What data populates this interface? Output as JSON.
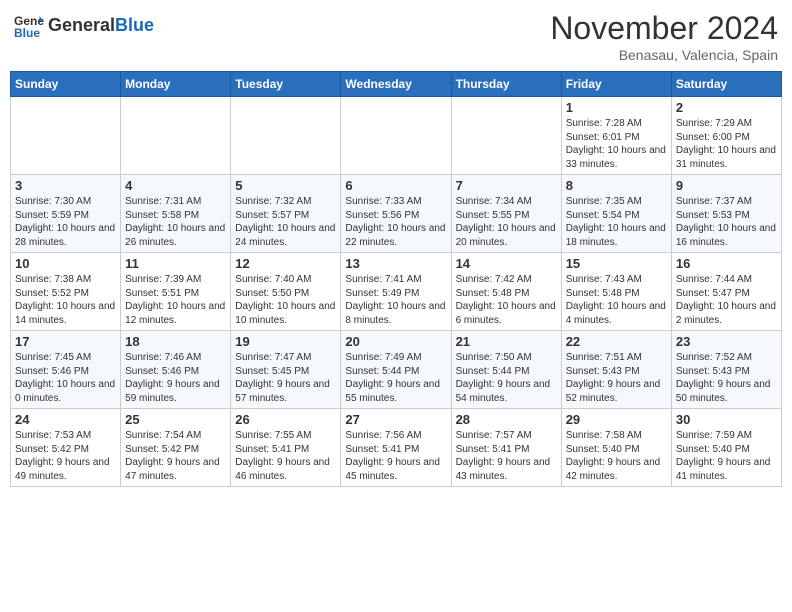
{
  "header": {
    "logo_general": "General",
    "logo_blue": "Blue",
    "month_title": "November 2024",
    "subtitle": "Benasau, Valencia, Spain"
  },
  "weekdays": [
    "Sunday",
    "Monday",
    "Tuesday",
    "Wednesday",
    "Thursday",
    "Friday",
    "Saturday"
  ],
  "weeks": [
    [
      {
        "day": "",
        "info": ""
      },
      {
        "day": "",
        "info": ""
      },
      {
        "day": "",
        "info": ""
      },
      {
        "day": "",
        "info": ""
      },
      {
        "day": "",
        "info": ""
      },
      {
        "day": "1",
        "info": "Sunrise: 7:28 AM\nSunset: 6:01 PM\nDaylight: 10 hours and 33 minutes."
      },
      {
        "day": "2",
        "info": "Sunrise: 7:29 AM\nSunset: 6:00 PM\nDaylight: 10 hours and 31 minutes."
      }
    ],
    [
      {
        "day": "3",
        "info": "Sunrise: 7:30 AM\nSunset: 5:59 PM\nDaylight: 10 hours and 28 minutes."
      },
      {
        "day": "4",
        "info": "Sunrise: 7:31 AM\nSunset: 5:58 PM\nDaylight: 10 hours and 26 minutes."
      },
      {
        "day": "5",
        "info": "Sunrise: 7:32 AM\nSunset: 5:57 PM\nDaylight: 10 hours and 24 minutes."
      },
      {
        "day": "6",
        "info": "Sunrise: 7:33 AM\nSunset: 5:56 PM\nDaylight: 10 hours and 22 minutes."
      },
      {
        "day": "7",
        "info": "Sunrise: 7:34 AM\nSunset: 5:55 PM\nDaylight: 10 hours and 20 minutes."
      },
      {
        "day": "8",
        "info": "Sunrise: 7:35 AM\nSunset: 5:54 PM\nDaylight: 10 hours and 18 minutes."
      },
      {
        "day": "9",
        "info": "Sunrise: 7:37 AM\nSunset: 5:53 PM\nDaylight: 10 hours and 16 minutes."
      }
    ],
    [
      {
        "day": "10",
        "info": "Sunrise: 7:38 AM\nSunset: 5:52 PM\nDaylight: 10 hours and 14 minutes."
      },
      {
        "day": "11",
        "info": "Sunrise: 7:39 AM\nSunset: 5:51 PM\nDaylight: 10 hours and 12 minutes."
      },
      {
        "day": "12",
        "info": "Sunrise: 7:40 AM\nSunset: 5:50 PM\nDaylight: 10 hours and 10 minutes."
      },
      {
        "day": "13",
        "info": "Sunrise: 7:41 AM\nSunset: 5:49 PM\nDaylight: 10 hours and 8 minutes."
      },
      {
        "day": "14",
        "info": "Sunrise: 7:42 AM\nSunset: 5:48 PM\nDaylight: 10 hours and 6 minutes."
      },
      {
        "day": "15",
        "info": "Sunrise: 7:43 AM\nSunset: 5:48 PM\nDaylight: 10 hours and 4 minutes."
      },
      {
        "day": "16",
        "info": "Sunrise: 7:44 AM\nSunset: 5:47 PM\nDaylight: 10 hours and 2 minutes."
      }
    ],
    [
      {
        "day": "17",
        "info": "Sunrise: 7:45 AM\nSunset: 5:46 PM\nDaylight: 10 hours and 0 minutes."
      },
      {
        "day": "18",
        "info": "Sunrise: 7:46 AM\nSunset: 5:46 PM\nDaylight: 9 hours and 59 minutes."
      },
      {
        "day": "19",
        "info": "Sunrise: 7:47 AM\nSunset: 5:45 PM\nDaylight: 9 hours and 57 minutes."
      },
      {
        "day": "20",
        "info": "Sunrise: 7:49 AM\nSunset: 5:44 PM\nDaylight: 9 hours and 55 minutes."
      },
      {
        "day": "21",
        "info": "Sunrise: 7:50 AM\nSunset: 5:44 PM\nDaylight: 9 hours and 54 minutes."
      },
      {
        "day": "22",
        "info": "Sunrise: 7:51 AM\nSunset: 5:43 PM\nDaylight: 9 hours and 52 minutes."
      },
      {
        "day": "23",
        "info": "Sunrise: 7:52 AM\nSunset: 5:43 PM\nDaylight: 9 hours and 50 minutes."
      }
    ],
    [
      {
        "day": "24",
        "info": "Sunrise: 7:53 AM\nSunset: 5:42 PM\nDaylight: 9 hours and 49 minutes."
      },
      {
        "day": "25",
        "info": "Sunrise: 7:54 AM\nSunset: 5:42 PM\nDaylight: 9 hours and 47 minutes."
      },
      {
        "day": "26",
        "info": "Sunrise: 7:55 AM\nSunset: 5:41 PM\nDaylight: 9 hours and 46 minutes."
      },
      {
        "day": "27",
        "info": "Sunrise: 7:56 AM\nSunset: 5:41 PM\nDaylight: 9 hours and 45 minutes."
      },
      {
        "day": "28",
        "info": "Sunrise: 7:57 AM\nSunset: 5:41 PM\nDaylight: 9 hours and 43 minutes."
      },
      {
        "day": "29",
        "info": "Sunrise: 7:58 AM\nSunset: 5:40 PM\nDaylight: 9 hours and 42 minutes."
      },
      {
        "day": "30",
        "info": "Sunrise: 7:59 AM\nSunset: 5:40 PM\nDaylight: 9 hours and 41 minutes."
      }
    ]
  ]
}
